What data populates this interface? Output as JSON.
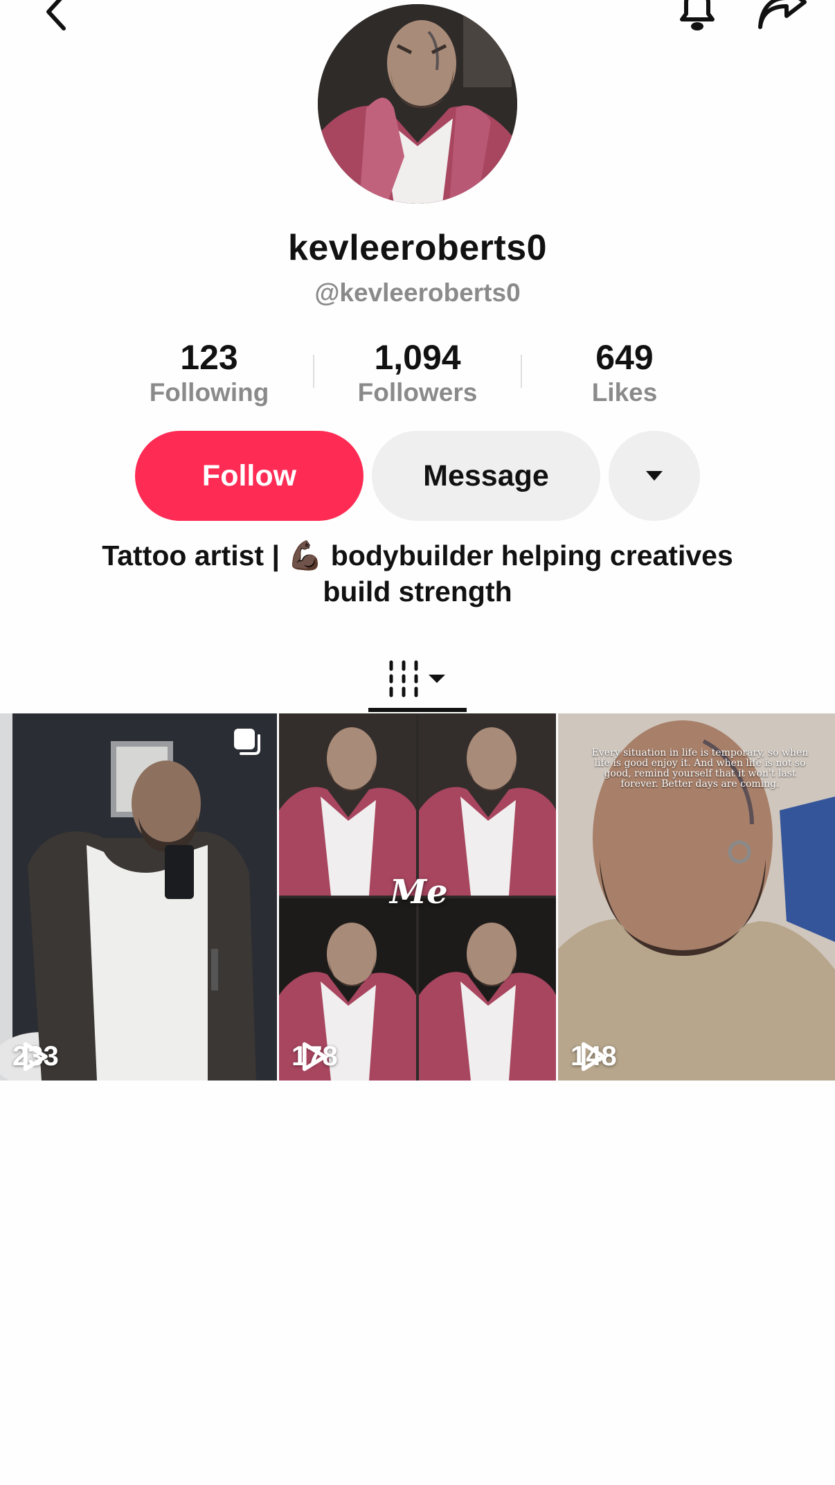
{
  "profile": {
    "display_name": "kevleeroberts0",
    "handle": "@kevleeroberts0",
    "bio_line1": "Tattoo artist | 💪🏿 bodybuilder helping creatives",
    "bio_line2": "build strength"
  },
  "stats": {
    "following_count": "123",
    "following_label": "Following",
    "followers_count": "1,094",
    "followers_label": "Followers",
    "likes_count": "649",
    "likes_label": "Likes"
  },
  "actions": {
    "follow_label": "Follow",
    "message_label": "Message"
  },
  "videos": [
    {
      "views": "233"
    },
    {
      "views": "178",
      "overlay_text": "Me"
    },
    {
      "views": "148",
      "overlay_text": "Every situation in life is temporary, so when life is good enjoy it. And when life is not so good, remind yourself that it won't last forever. Better days are coming."
    }
  ],
  "colors": {
    "accent": "#fe2c55",
    "secondary_button": "#efefef",
    "muted_text": "#8a8a8a"
  },
  "icons": {
    "back": "chevron-left-icon",
    "notifications": "bell-icon",
    "share": "share-arrow-icon",
    "more": "caret-down-icon",
    "videos_tab": "grid-bars-icon",
    "play": "play-icon",
    "multi": "multi-post-icon"
  }
}
